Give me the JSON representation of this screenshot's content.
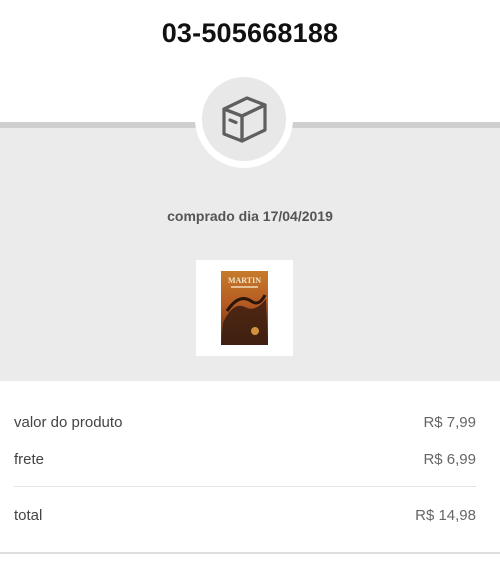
{
  "order": {
    "number": "03-505668188"
  },
  "purchase": {
    "date_text": "comprado dia 17/04/2019"
  },
  "product": {
    "cover_author": "MARTIN"
  },
  "summary": {
    "product_label": "valor do produto",
    "product_value": "R$ 7,99",
    "shipping_label": "frete",
    "shipping_value": "R$ 6,99",
    "total_label": "total",
    "total_value": "R$ 14,98"
  },
  "icons": {
    "status": "package-box-icon"
  },
  "colors": {
    "panel": "#ebebeb",
    "title": "#111111",
    "text": "#444444"
  }
}
